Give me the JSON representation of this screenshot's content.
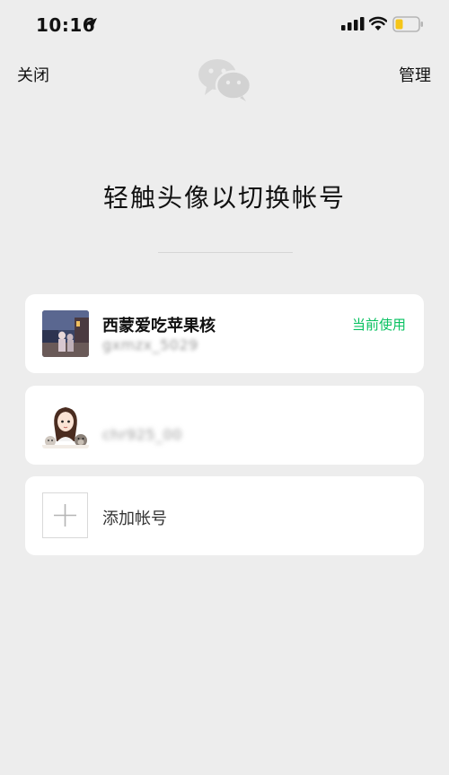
{
  "status_bar": {
    "time": "10:16",
    "icons": [
      "location-arrow-icon",
      "signal-icon",
      "wifi-icon",
      "battery-icon"
    ],
    "battery_color": "#f5c518"
  },
  "nav": {
    "close_label": "关闭",
    "manage_label": "管理",
    "logo": "wechat-logo-icon"
  },
  "headline": "轻触头像以切换帐号",
  "accounts": [
    {
      "name": "西蒙爱吃苹果核",
      "id": "gxmzx_5029",
      "tag": "当前使用",
      "avatar": "landscape-photo-avatar"
    },
    {
      "name": "",
      "id": "chr925_00",
      "tag": "",
      "avatar": "cartoon-girl-avatar"
    }
  ],
  "add_account": {
    "label": "添加帐号",
    "icon": "plus-icon"
  },
  "colors": {
    "background": "#ededed",
    "card": "#ffffff",
    "accent_green": "#07c160",
    "muted_text": "#9a9a9a"
  }
}
